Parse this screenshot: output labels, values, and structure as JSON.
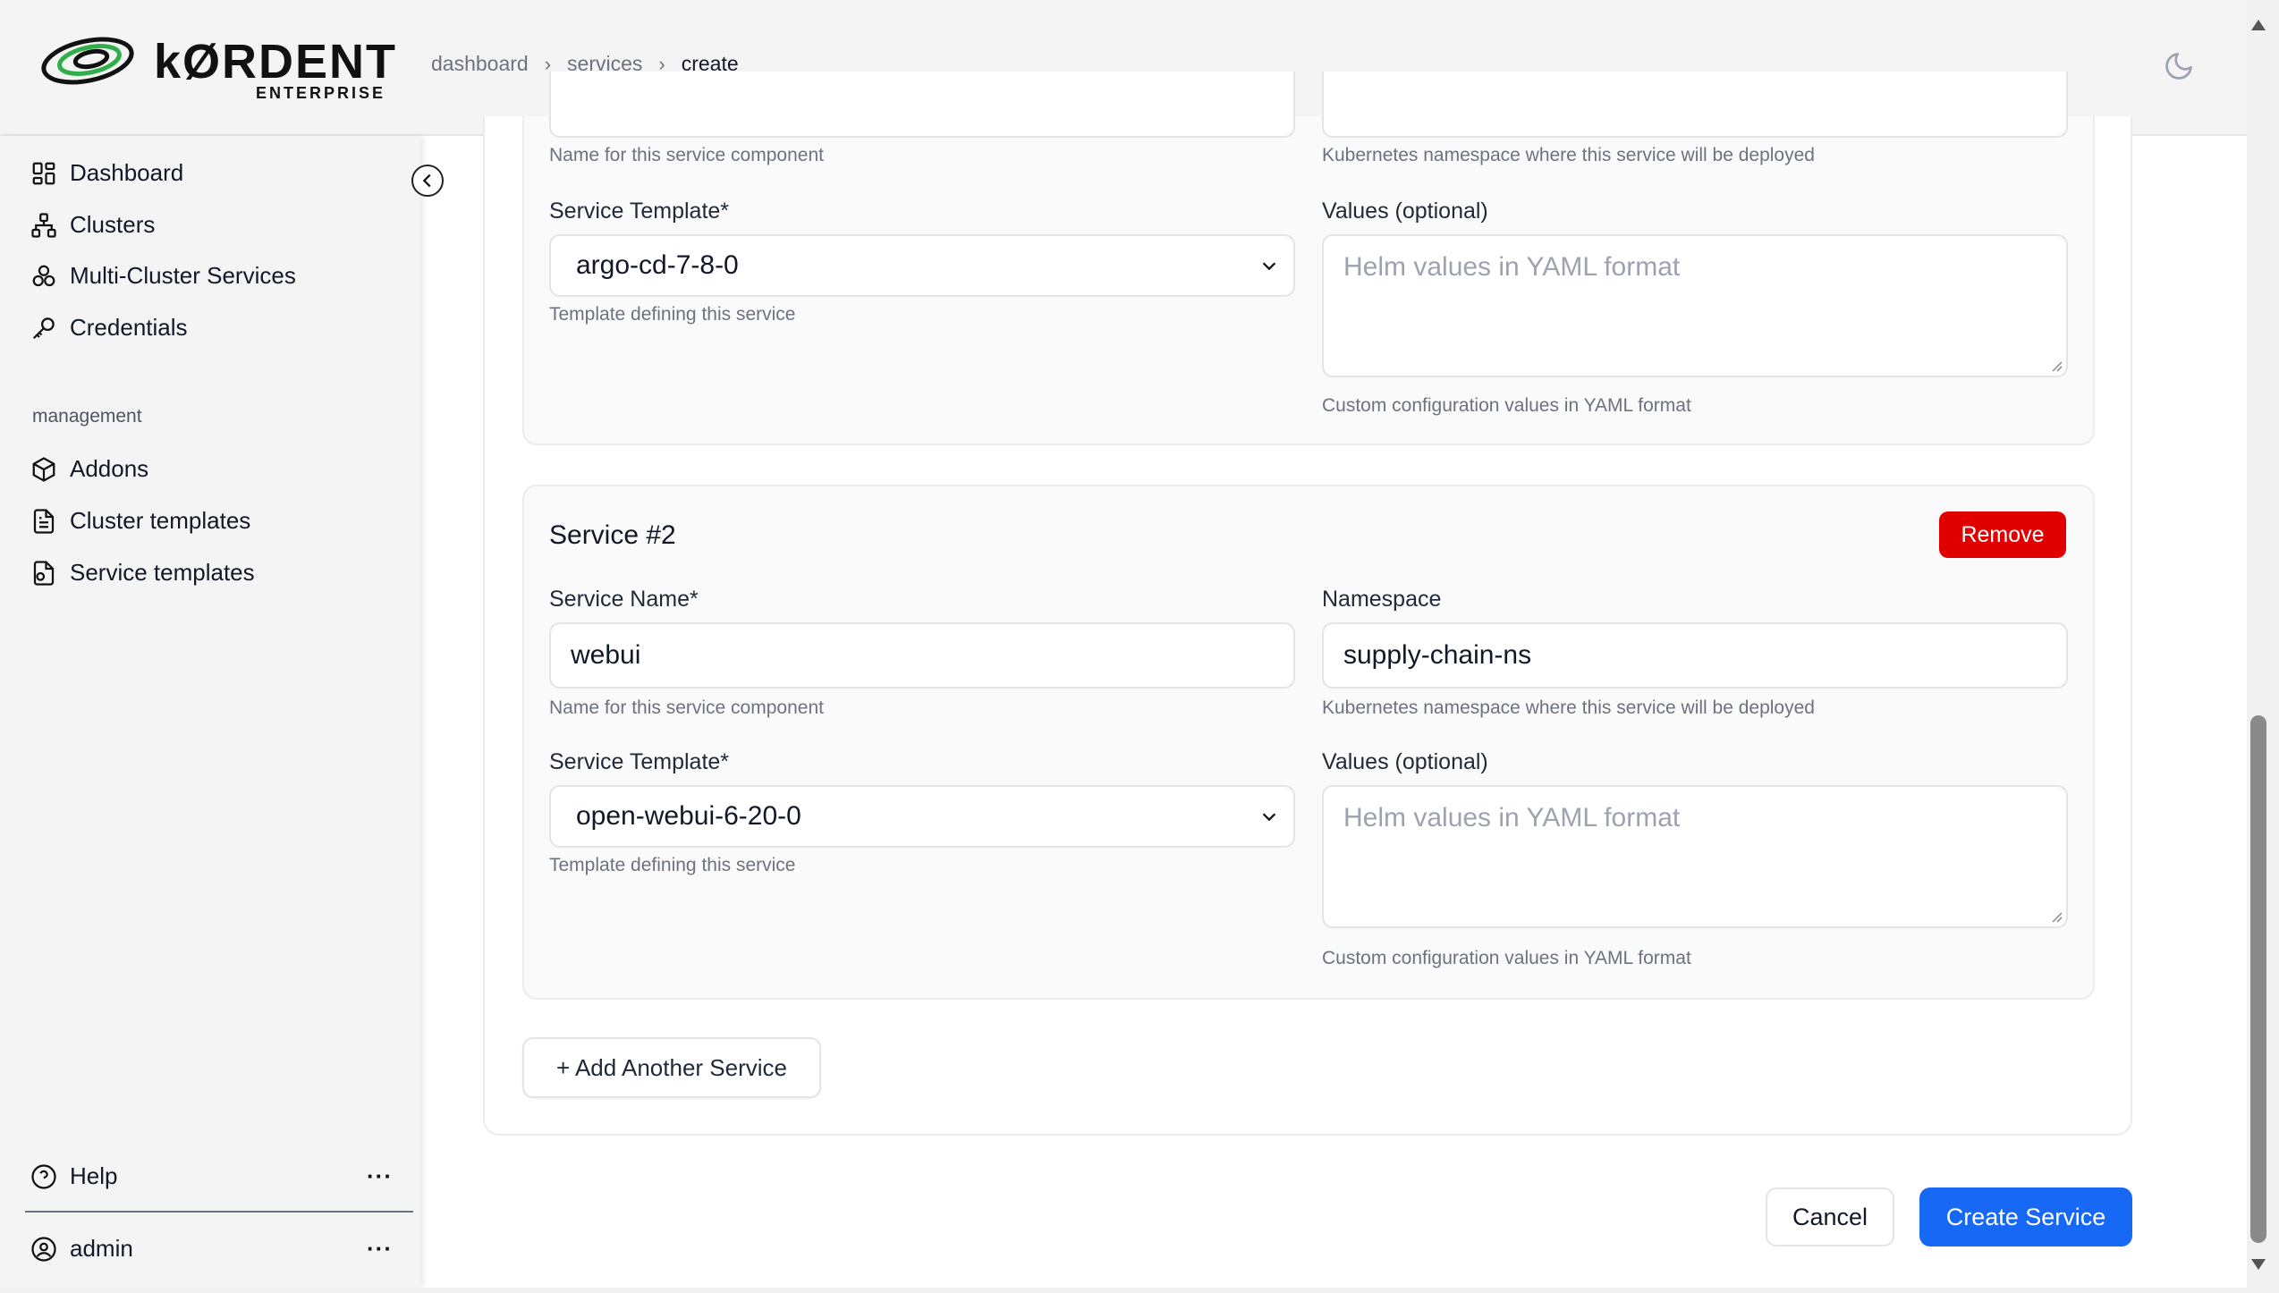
{
  "brand": {
    "name": "kØRDENT",
    "sub": "ENTERPRISE"
  },
  "breadcrumb": [
    "dashboard",
    "services",
    "create"
  ],
  "sidebar": {
    "items": [
      {
        "label": "Dashboard",
        "icon": "dashboard-grid-icon"
      },
      {
        "label": "Clusters",
        "icon": "network-icon"
      },
      {
        "label": "Multi-Cluster Services",
        "icon": "boxes-icon"
      },
      {
        "label": "Credentials",
        "icon": "key-icon"
      }
    ],
    "section_label": "management",
    "management_items": [
      {
        "label": "Addons",
        "icon": "package-icon"
      },
      {
        "label": "Cluster templates",
        "icon": "file-icon"
      },
      {
        "label": "Service templates",
        "icon": "file-code-icon"
      }
    ],
    "help_label": "Help",
    "user_label": "admin",
    "more": "···"
  },
  "service1": {
    "name_hint": "Name for this service component",
    "namespace_hint": "Kubernetes namespace where this service will be deployed",
    "template_label": "Service Template*",
    "template_value": "argo-cd-7-8-0",
    "template_hint": "Template defining this service",
    "values_label": "Values (optional)",
    "values_placeholder": "Helm values in YAML format",
    "values_hint": "Custom configuration values in YAML format"
  },
  "service2": {
    "title": "Service #2",
    "remove_label": "Remove",
    "name_label": "Service Name*",
    "name_value": "webui",
    "name_hint": "Name for this service component",
    "namespace_label": "Namespace",
    "namespace_value": "supply-chain-ns",
    "namespace_hint": "Kubernetes namespace where this service will be deployed",
    "template_label": "Service Template*",
    "template_value": "open-webui-6-20-0",
    "template_hint": "Template defining this service",
    "values_label": "Values (optional)",
    "values_placeholder": "Helm values in YAML format",
    "values_hint": "Custom configuration values in YAML format"
  },
  "actions": {
    "add_service": "+ Add Another Service",
    "cancel": "Cancel",
    "create": "Create Service"
  }
}
